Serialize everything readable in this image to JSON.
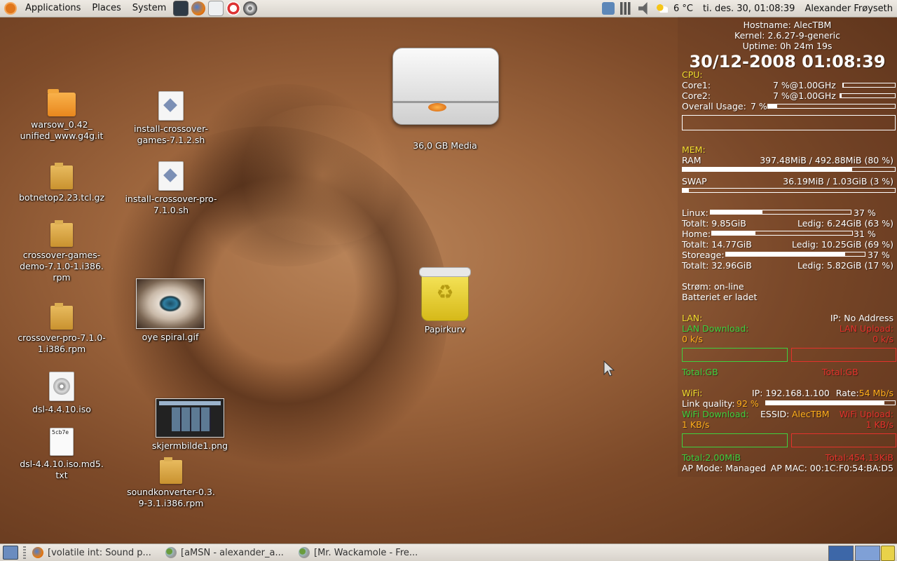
{
  "top_panel": {
    "menus": [
      "Applications",
      "Places",
      "System"
    ],
    "launchers": [
      "terminal-icon",
      "firefox-icon",
      "mail-icon",
      "help-icon",
      "app-icon"
    ],
    "weather": "6 °C",
    "clock": "ti. des. 30, 01:08:39",
    "user": "Alexander Frøyseth"
  },
  "desktop_icons": {
    "warsow": "warsow_0.42_\nunified_www.g4g.it",
    "botnetop": "botnetop2.23.tcl.gz",
    "crossover_games_demo": "crossover-games-\ndemo-7.1.0-1.i386.\nrpm",
    "crossover_pro": "crossover-pro-7.1.0-\n1.i386.rpm",
    "dsl_iso": "dsl-4.4.10.iso",
    "dsl_md5": "dsl-4.4.10.iso.md5.\ntxt",
    "dsl_md5_preview": "5cb7e",
    "install_crossover_games": "install-crossover-\ngames-7.1.2.sh",
    "install_crossover_pro": "install-crossover-pro-\n7.1.0.sh",
    "oye_spiral": "oye spiral.gif",
    "skjermbilde": "skjermbilde1.png",
    "soundkonverter": "soundkonverter-0.3.\n9-3.1.i386.rpm",
    "media": "36,0 GB Media",
    "trash": "Papirkurv"
  },
  "conky": {
    "hostname": "Hostname: AlecTBM",
    "kernel": "Kernel: 2.6.27-9-generic",
    "uptime": "Uptime: 0h 24m 19s",
    "datetime": "30/12-2008 01:08:39",
    "cpu_label": "CPU:",
    "core1_label": "Core1:",
    "core1_val": "7  %@1.00GHz",
    "core1_pct": 2,
    "core2_label": "Core2:",
    "core2_val": "7  %@1.00GHz",
    "core2_pct": 2,
    "overall_label": "Overall Usage:",
    "overall_val": "7  %",
    "overall_pct": 7,
    "mem_label": "MEM:",
    "ram_label": "RAM",
    "ram_val": "397.48MiB / 492.88MiB (80 %)",
    "ram_pct": 80,
    "swap_label": "SWAP",
    "swap_val": "36.19MiB  / 1.03GiB  (3  %)",
    "swap_pct": 3,
    "linux_label": "Linux:",
    "linux_pct_text": "37 %",
    "linux_pct": 37,
    "linux_total": "Totalt: 9.85GiB",
    "linux_free": "Ledig: 6.24GiB  (63 %)",
    "home_label": "Home:",
    "home_pct_text": "31 %",
    "home_pct": 31,
    "home_total": "Totalt: 14.77GiB",
    "home_free": "Ledig: 10.25GiB (69 %)",
    "storage_label": "Storeage:",
    "storage_pct_text": "37 %",
    "storage_pct": 86,
    "storage_total": "Totalt: 32.96GiB",
    "storage_free": "Ledig: 5.82GiB  (17 %)",
    "power": "Strøm: on-line",
    "battery": "Batteriet er ladet",
    "lan_label": "LAN:",
    "lan_ip": "IP: No Address",
    "lan_dl_label": "LAN Download:",
    "lan_ul_label": "LAN Upload:",
    "lan_dl_val": "0     k/s",
    "lan_ul_val": "0     k/s",
    "lan_total_dl": "Total:GB",
    "lan_total_ul": "Total:GB",
    "wifi_label": "WiFi:",
    "wifi_ip": "IP: 192.168.1.100",
    "wifi_rate_label": "Rate:",
    "wifi_rate": "54 Mb/s",
    "link_quality_label": "Link quality:",
    "link_quality_val": "92  %",
    "link_quality_pct": 92,
    "wifi_dl_label": "WiFi Download:",
    "essid_label": "ESSID:",
    "essid": "AlecTBM",
    "wifi_ul_label": "WiFi Upload:",
    "wifi_dl_val": "1     KB/s",
    "wifi_ul_val": "1     KB/s",
    "wifi_total_dl": "Total:2.00MiB",
    "wifi_total_ul": "Total:454.13KiB",
    "ap_mode": "AP Mode: Managed",
    "ap_mac": "AP MAC: 00:1C:F0:54:BA:D5"
  },
  "bottom_panel": {
    "tasks": [
      "[volatile int: Sound p...",
      "[aMSN - alexander_a...",
      "[Mr. Wackamole - Fre..."
    ]
  },
  "colors": {
    "conky_heading": "#f1dc2e",
    "lan_download": "#3fd13f",
    "lan_upload": "#e4322c",
    "wifi_value": "#ffae1a"
  }
}
